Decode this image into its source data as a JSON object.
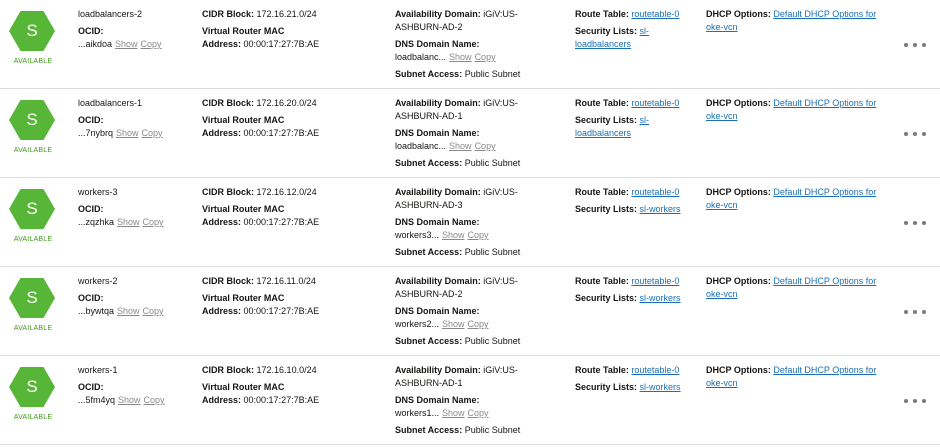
{
  "colors": {
    "hex_fill": "#57b637",
    "status_green": "#3f9a1c",
    "link": "#1a6fb5"
  },
  "labels": {
    "ocid": "OCID:",
    "cidr": "CIDR Block:",
    "vr_mac_1": "Virtual Router MAC",
    "vr_mac_2": "Address:",
    "avail": "Availability Domain:",
    "dns": "DNS Domain Name:",
    "subnet_access": "Subnet Access:",
    "route_table": "Route Table:",
    "security_lists": "Security Lists:",
    "dhcp": "DHCP Options:",
    "show": "Show",
    "copy": "Copy"
  },
  "rows": [
    {
      "icon_letter": "S",
      "state": "AVAILABLE",
      "name": "loadbalancers-2",
      "ocid": "...aikdoa",
      "cidr": "172.16.21.0/24",
      "mac": "00:00:17:27:7B:AE",
      "avail_1": "iGiV:US-",
      "avail_2": "ASHBURN-AD-2",
      "dns": "loadbalanc...",
      "subnet_access": "Public Subnet",
      "route_table": "routetable-0",
      "security_1": "sl-",
      "security_2": "loadbalancers",
      "dhcp_1": "Default DHCP Options for",
      "dhcp_2": "oke-vcn"
    },
    {
      "icon_letter": "S",
      "state": "AVAILABLE",
      "name": "loadbalancers-1",
      "ocid": "...7nybrq",
      "cidr": "172.16.20.0/24",
      "mac": "00:00:17:27:7B:AE",
      "avail_1": "iGiV:US-",
      "avail_2": "ASHBURN-AD-1",
      "dns": "loadbalanc...",
      "subnet_access": "Public Subnet",
      "route_table": "routetable-0",
      "security_1": "sl-",
      "security_2": "loadbalancers",
      "dhcp_1": "Default DHCP Options for",
      "dhcp_2": "oke-vcn"
    },
    {
      "icon_letter": "S",
      "state": "AVAILABLE",
      "name": "workers-3",
      "ocid": "...zqzhka",
      "cidr": "172.16.12.0/24",
      "mac": "00:00:17:27:7B:AE",
      "avail_1": "iGiV:US-",
      "avail_2": "ASHBURN-AD-3",
      "dns": "workers3...",
      "subnet_access": "Public Subnet",
      "route_table": "routetable-0",
      "security_1": "sl-workers",
      "security_2": "",
      "dhcp_1": "Default DHCP Options for",
      "dhcp_2": "oke-vcn"
    },
    {
      "icon_letter": "S",
      "state": "AVAILABLE",
      "name": "workers-2",
      "ocid": "...bywtqa",
      "cidr": "172.16.11.0/24",
      "mac": "00:00:17:27:7B:AE",
      "avail_1": "iGiV:US-",
      "avail_2": "ASHBURN-AD-2",
      "dns": "workers2...",
      "subnet_access": "Public Subnet",
      "route_table": "routetable-0",
      "security_1": "sl-workers",
      "security_2": "",
      "dhcp_1": "Default DHCP Options for",
      "dhcp_2": "oke-vcn"
    },
    {
      "icon_letter": "S",
      "state": "AVAILABLE",
      "name": "workers-1",
      "ocid": "...5fm4yq",
      "cidr": "172.16.10.0/24",
      "mac": "00:00:17:27:7B:AE",
      "avail_1": "iGiV:US-",
      "avail_2": "ASHBURN-AD-1",
      "dns": "workers1...",
      "subnet_access": "Public Subnet",
      "route_table": "routetable-0",
      "security_1": "sl-workers",
      "security_2": "",
      "dhcp_1": "Default DHCP Options for",
      "dhcp_2": "oke-vcn"
    }
  ]
}
